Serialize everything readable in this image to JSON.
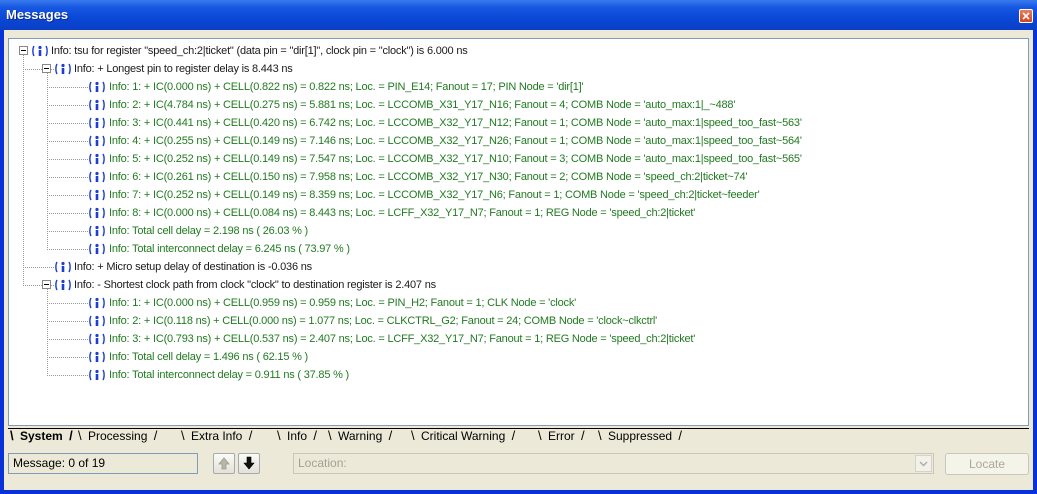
{
  "window": {
    "title": "Messages"
  },
  "messages": [
    {
      "level": 0,
      "expander": true,
      "text": "Info: tsu for register \"speed_ch:2|ticket\" (data pin = \"dir[1]\", clock pin = \"clock\") is 6.000 ns"
    },
    {
      "level": 1,
      "expander": true,
      "text": "Info: + Longest pin to register delay is 8.443 ns"
    },
    {
      "level": 2,
      "expander": false,
      "text": "Info: 1: + IC(0.000 ns) + CELL(0.822 ns) = 0.822 ns; Loc. = PIN_E14; Fanout = 17; PIN Node = 'dir[1]'"
    },
    {
      "level": 2,
      "expander": false,
      "text": "Info: 2: + IC(4.784 ns) + CELL(0.275 ns) = 5.881 ns; Loc. = LCCOMB_X31_Y17_N16; Fanout = 4; COMB Node = 'auto_max:1|_~488'"
    },
    {
      "level": 2,
      "expander": false,
      "text": "Info: 3: + IC(0.441 ns) + CELL(0.420 ns) = 6.742 ns; Loc. = LCCOMB_X32_Y17_N12; Fanout = 1; COMB Node = 'auto_max:1|speed_too_fast~563'"
    },
    {
      "level": 2,
      "expander": false,
      "text": "Info: 4: + IC(0.255 ns) + CELL(0.149 ns) = 7.146 ns; Loc. = LCCOMB_X32_Y17_N26; Fanout = 1; COMB Node = 'auto_max:1|speed_too_fast~564'"
    },
    {
      "level": 2,
      "expander": false,
      "text": "Info: 5: + IC(0.252 ns) + CELL(0.149 ns) = 7.547 ns; Loc. = LCCOMB_X32_Y17_N10; Fanout = 3; COMB Node = 'auto_max:1|speed_too_fast~565'"
    },
    {
      "level": 2,
      "expander": false,
      "text": "Info: 6: + IC(0.261 ns) + CELL(0.150 ns) = 7.958 ns; Loc. = LCCOMB_X32_Y17_N30; Fanout = 2; COMB Node = 'speed_ch:2|ticket~74'"
    },
    {
      "level": 2,
      "expander": false,
      "text": "Info: 7: + IC(0.252 ns) + CELL(0.149 ns) = 8.359 ns; Loc. = LCCOMB_X32_Y17_N6; Fanout = 1; COMB Node = 'speed_ch:2|ticket~feeder'"
    },
    {
      "level": 2,
      "expander": false,
      "text": "Info: 8: + IC(0.000 ns) + CELL(0.084 ns) = 8.443 ns; Loc. = LCFF_X32_Y17_N7; Fanout = 1; REG Node = 'speed_ch:2|ticket'"
    },
    {
      "level": 2,
      "expander": false,
      "text": "Info: Total cell delay = 2.198 ns ( 26.03 % )"
    },
    {
      "level": 2,
      "expander": false,
      "text": "Info: Total interconnect delay = 6.245 ns ( 73.97 % )"
    },
    {
      "level": 1,
      "expander": false,
      "text": "Info: + Micro setup delay of destination is -0.036 ns"
    },
    {
      "level": 1,
      "expander": true,
      "text": "Info: - Shortest clock path from clock \"clock\" to destination register is 2.407 ns"
    },
    {
      "level": 2,
      "expander": false,
      "text": "Info: 1: + IC(0.000 ns) + CELL(0.959 ns) = 0.959 ns; Loc. = PIN_H2; Fanout = 1; CLK Node = 'clock'"
    },
    {
      "level": 2,
      "expander": false,
      "text": "Info: 2: + IC(0.118 ns) + CELL(0.000 ns) = 1.077 ns; Loc. = CLKCTRL_G2; Fanout = 24; COMB Node = 'clock~clkctrl'"
    },
    {
      "level": 2,
      "expander": false,
      "text": "Info: 3: + IC(0.793 ns) + CELL(0.537 ns) = 2.407 ns; Loc. = LCFF_X32_Y17_N7; Fanout = 1; REG Node = 'speed_ch:2|ticket'"
    },
    {
      "level": 2,
      "expander": false,
      "text": "Info: Total cell delay = 1.496 ns ( 62.15 % )"
    },
    {
      "level": 2,
      "expander": false,
      "text": "Info: Total interconnect delay = 0.911 ns ( 37.85 % )"
    }
  ],
  "tabs": [
    {
      "label": "System",
      "active": true
    },
    {
      "label": "Processing",
      "active": false
    },
    {
      "label": "Extra Info",
      "active": false
    },
    {
      "label": "Info",
      "active": false
    },
    {
      "label": "Warning",
      "active": false
    },
    {
      "label": "Critical Warning",
      "active": false
    },
    {
      "label": "Error",
      "active": false
    },
    {
      "label": "Suppressed",
      "active": false
    }
  ],
  "status": {
    "message_count": "Message: 0 of 19",
    "location_placeholder": "Location:",
    "locate_label": "Locate"
  },
  "colors": {
    "title_bar": "#0a48d6",
    "level2_text": "#217a21",
    "info_icon": "#1d3fd0"
  },
  "icons": {
    "close": "close-icon",
    "info": "info-icon",
    "prev": "arrow-up-icon",
    "next": "arrow-down-icon",
    "dropdown": "chevron-down-icon"
  }
}
